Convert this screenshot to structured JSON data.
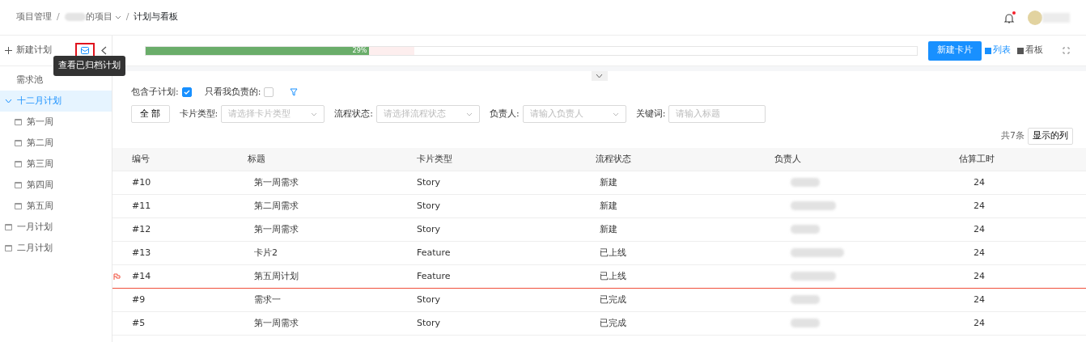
{
  "breadcrumb": [
    {
      "label": "项目管理",
      "blurred_prefix": false,
      "dropdown": false
    },
    {
      "separator": "/",
      "label": "的项目",
      "blurred_prefix": true,
      "dropdown": true
    },
    {
      "separator": "/",
      "label": "计划与看板",
      "blurred_prefix": false,
      "dropdown": false
    }
  ],
  "header": {
    "notification_dot": true
  },
  "tooltip": "查看已归档计划",
  "sidebar": {
    "new_plan": "新建计划",
    "items": [
      {
        "label": "需求池",
        "kind": "plain",
        "selected": false,
        "expanded": false
      },
      {
        "label": "十二月计划",
        "kind": "plain",
        "selected": true,
        "expanded": true,
        "children": [
          {
            "label": "第一周",
            "kind": "calendar",
            "selected": false
          },
          {
            "label": "第二周",
            "kind": "calendar",
            "selected": false
          },
          {
            "label": "第三周",
            "kind": "calendar",
            "selected": false
          },
          {
            "label": "第四周",
            "kind": "calendar",
            "selected": false
          },
          {
            "label": "第五周",
            "kind": "calendar",
            "selected": false
          }
        ]
      },
      {
        "label": "一月计划",
        "kind": "calendar",
        "selected": false,
        "expanded": false
      },
      {
        "label": "二月计划",
        "kind": "calendar",
        "selected": false,
        "expanded": false
      }
    ]
  },
  "progress": {
    "level": 0.29,
    "reading": "29%"
  },
  "toolbar": {
    "new_card": "新建卡片",
    "views": [
      {
        "label": "列表",
        "selected": true
      },
      {
        "label": "看板",
        "selected": false
      }
    ]
  },
  "panel_toggle": {
    "expanded": false
  },
  "options": [
    {
      "label": "包含子计划:",
      "checked": true
    },
    {
      "label": "只看我负责的:",
      "checked": false
    }
  ],
  "filters": {
    "all": "全 部",
    "fields": [
      {
        "label": "卡片类型:",
        "placeholder": "请选择卡片类型",
        "kind": "select"
      },
      {
        "label": "流程状态:",
        "placeholder": "请选择流程状态",
        "kind": "select"
      },
      {
        "label": "负责人:",
        "placeholder": "请输入负责人",
        "kind": "select"
      },
      {
        "label": "关键词:",
        "placeholder": "请输入标题",
        "kind": "input"
      }
    ]
  },
  "count": "共7条",
  "columns_button": "显示的列",
  "table": {
    "columns": [
      "编号",
      "标题",
      "卡片类型",
      "流程状态",
      "负责人",
      "估算工时"
    ],
    "rows": [
      {
        "id": "#10",
        "title": "第一周需求",
        "type": "Story",
        "status": "新建",
        "hours": "24",
        "flagged": false
      },
      {
        "id": "#11",
        "title": "第二周需求",
        "type": "Story",
        "status": "新建",
        "hours": "24",
        "flagged": false
      },
      {
        "id": "#12",
        "title": "第一周需求",
        "type": "Story",
        "status": "新建",
        "hours": "24",
        "flagged": false
      },
      {
        "id": "#13",
        "title": "卡片2",
        "type": "Feature",
        "status": "已上线",
        "hours": "24",
        "flagged": false
      },
      {
        "id": "#14",
        "title": "第五周计划",
        "type": "Feature",
        "status": "已上线",
        "hours": "24",
        "flagged": true
      },
      {
        "id": "#9",
        "title": "需求一",
        "type": "Story",
        "status": "已完成",
        "hours": "24",
        "flagged": false
      },
      {
        "id": "#5",
        "title": "第一周需求",
        "type": "Story",
        "status": "已完成",
        "hours": "24",
        "flagged": false
      }
    ]
  }
}
